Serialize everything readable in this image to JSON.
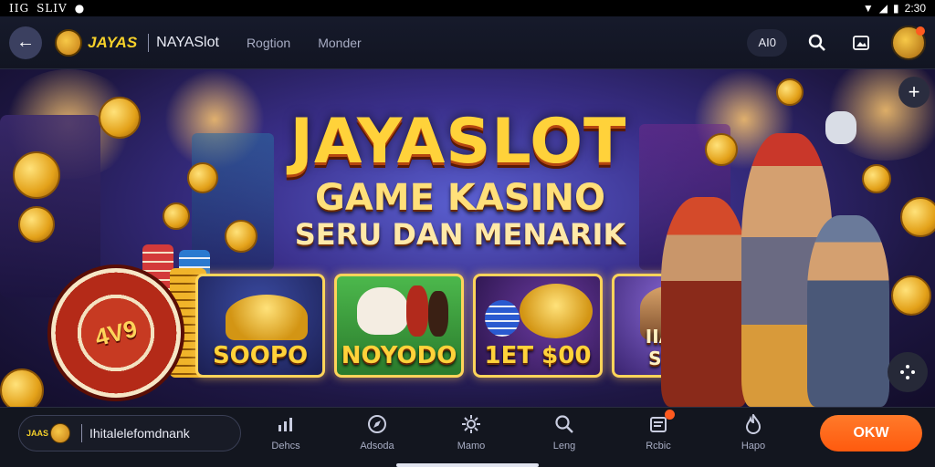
{
  "status_bar": {
    "time": "IIG",
    "carrier": "SLIV",
    "battery": "2:30"
  },
  "header": {
    "logo_text": "JAYAS",
    "brand": "NAYASlot",
    "nav": [
      "Rogtion",
      "Monder"
    ],
    "balance_pill": "AI0"
  },
  "hero": {
    "title": "JAYASLOT",
    "subtitle": "GAME KASINO",
    "tagline": "SERU DAN MENARIK",
    "chip_label": "4V9",
    "tiles": [
      {
        "label": "SOOPO"
      },
      {
        "label": "NOYODO"
      },
      {
        "label": "1ET $00"
      },
      {
        "label": "IIASUI SVIIO"
      }
    ]
  },
  "bottom": {
    "mini_logo_text": "JAAS",
    "brand_name": "Ihitalelefomdnank",
    "nav": [
      {
        "label": "Dehcs",
        "icon": "chart-icon"
      },
      {
        "label": "Adsoda",
        "icon": "compass-icon"
      },
      {
        "label": "Mamo",
        "icon": "gear-icon"
      },
      {
        "label": "Leng",
        "icon": "search-icon"
      },
      {
        "label": "Rcbic",
        "icon": "document-icon"
      },
      {
        "label": "Hapo",
        "icon": "flame-icon"
      }
    ],
    "cta": "OKW"
  },
  "colors": {
    "accent": "#ff5a0e",
    "gold": "#ffd23a",
    "background": "#13161f"
  }
}
